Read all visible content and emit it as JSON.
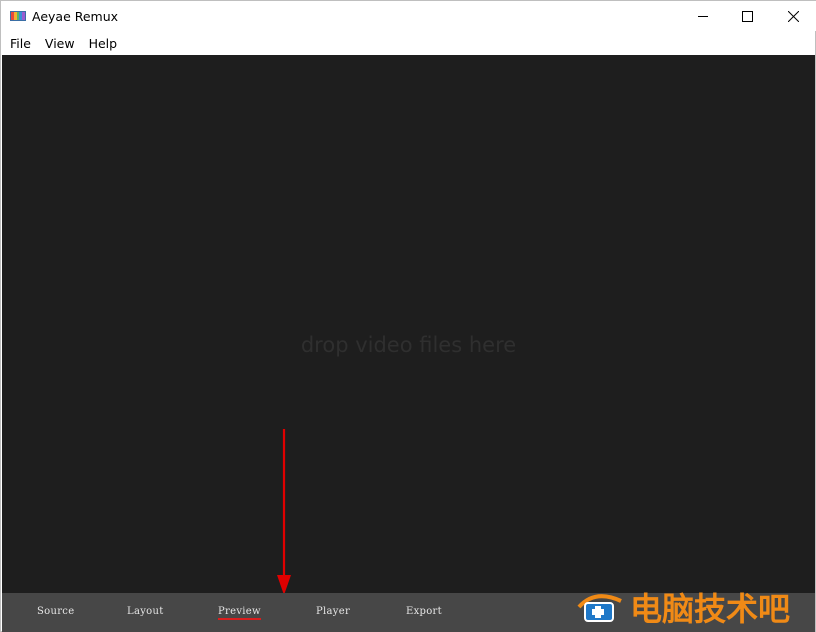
{
  "window": {
    "title": "Aeyae Remux",
    "controls": [
      "minimize-icon",
      "maximize-icon",
      "close-icon"
    ]
  },
  "menu": {
    "items": [
      "File",
      "View",
      "Help"
    ]
  },
  "main": {
    "drop_hint": "drop video files here",
    "background": "#1e1e1e"
  },
  "tabs": {
    "items": [
      "Source",
      "Layout",
      "Preview",
      "Player",
      "Export"
    ],
    "active": "Preview",
    "underline_color": "#d91e1e"
  },
  "annotation": {
    "arrow_color": "#e00000"
  },
  "watermark": {
    "text": "电脑技术吧",
    "color": "#f08a16"
  }
}
